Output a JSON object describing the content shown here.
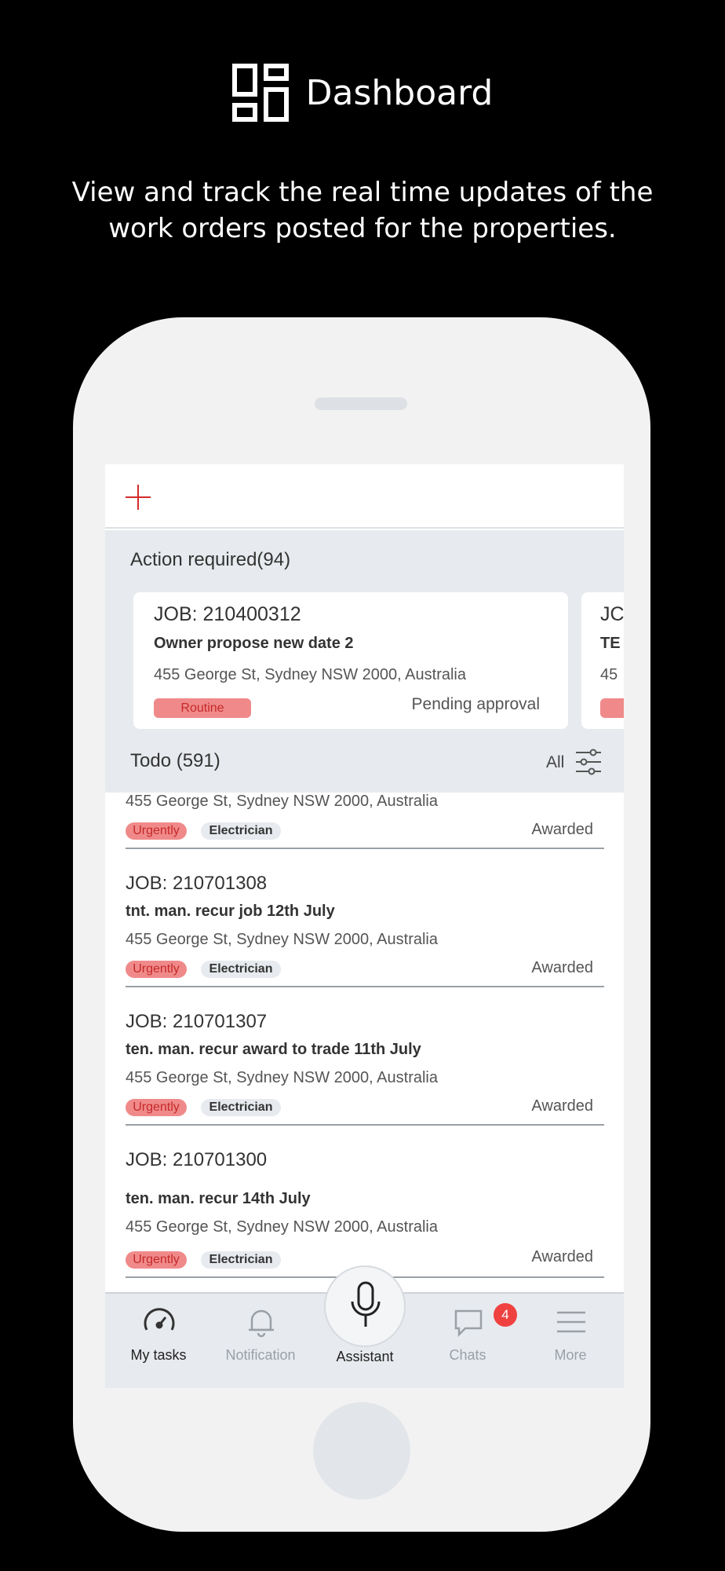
{
  "hero": {
    "title": "Dashboard",
    "subtitle": "View and track the real time updates of the work orders posted for the properties."
  },
  "colors": {
    "accent": "#d42b2b",
    "urgent_bg": "#f08a8a",
    "panel_bg": "#e7eaee",
    "badge_red": "#f04141"
  },
  "action_required": {
    "title": "Action required(94)",
    "cards": [
      {
        "job": "JOB: 210400312",
        "name": "Owner propose new date 2",
        "address": "455 George St, Sydney NSW 2000, Australia",
        "tag": "Routine",
        "status": "Pending approval"
      },
      {
        "job": "JC",
        "name": "TE",
        "address": "45"
      }
    ]
  },
  "todo": {
    "title": "Todo (591)",
    "filter_label": "All"
  },
  "jobs": [
    {
      "address": "455 George St, Sydney NSW 2000, Australia",
      "priority": "Urgently",
      "trade": "Electrician",
      "status": "Awarded"
    },
    {
      "job": "JOB: 210701308",
      "name": "tnt. man. recur job 12th July",
      "address": "455 George St, Sydney NSW 2000, Australia",
      "priority": "Urgently",
      "trade": "Electrician",
      "status": "Awarded"
    },
    {
      "job": "JOB: 210701307",
      "name": "ten. man. recur award to trade 11th July",
      "address": "455 George St, Sydney NSW 2000, Australia",
      "priority": "Urgently",
      "trade": "Electrician",
      "status": "Awarded"
    },
    {
      "job": "JOB: 210701300",
      "name": "ten. man. recur 14th July",
      "address": "455 George St, Sydney NSW 2000, Australia",
      "priority": "Urgently",
      "trade": "Electrician",
      "status": "Awarded"
    }
  ],
  "tabs": {
    "my_tasks": "My tasks",
    "notification": "Notification",
    "assistant": "Assistant",
    "chats": "Chats",
    "chats_badge": "4",
    "more": "More"
  }
}
